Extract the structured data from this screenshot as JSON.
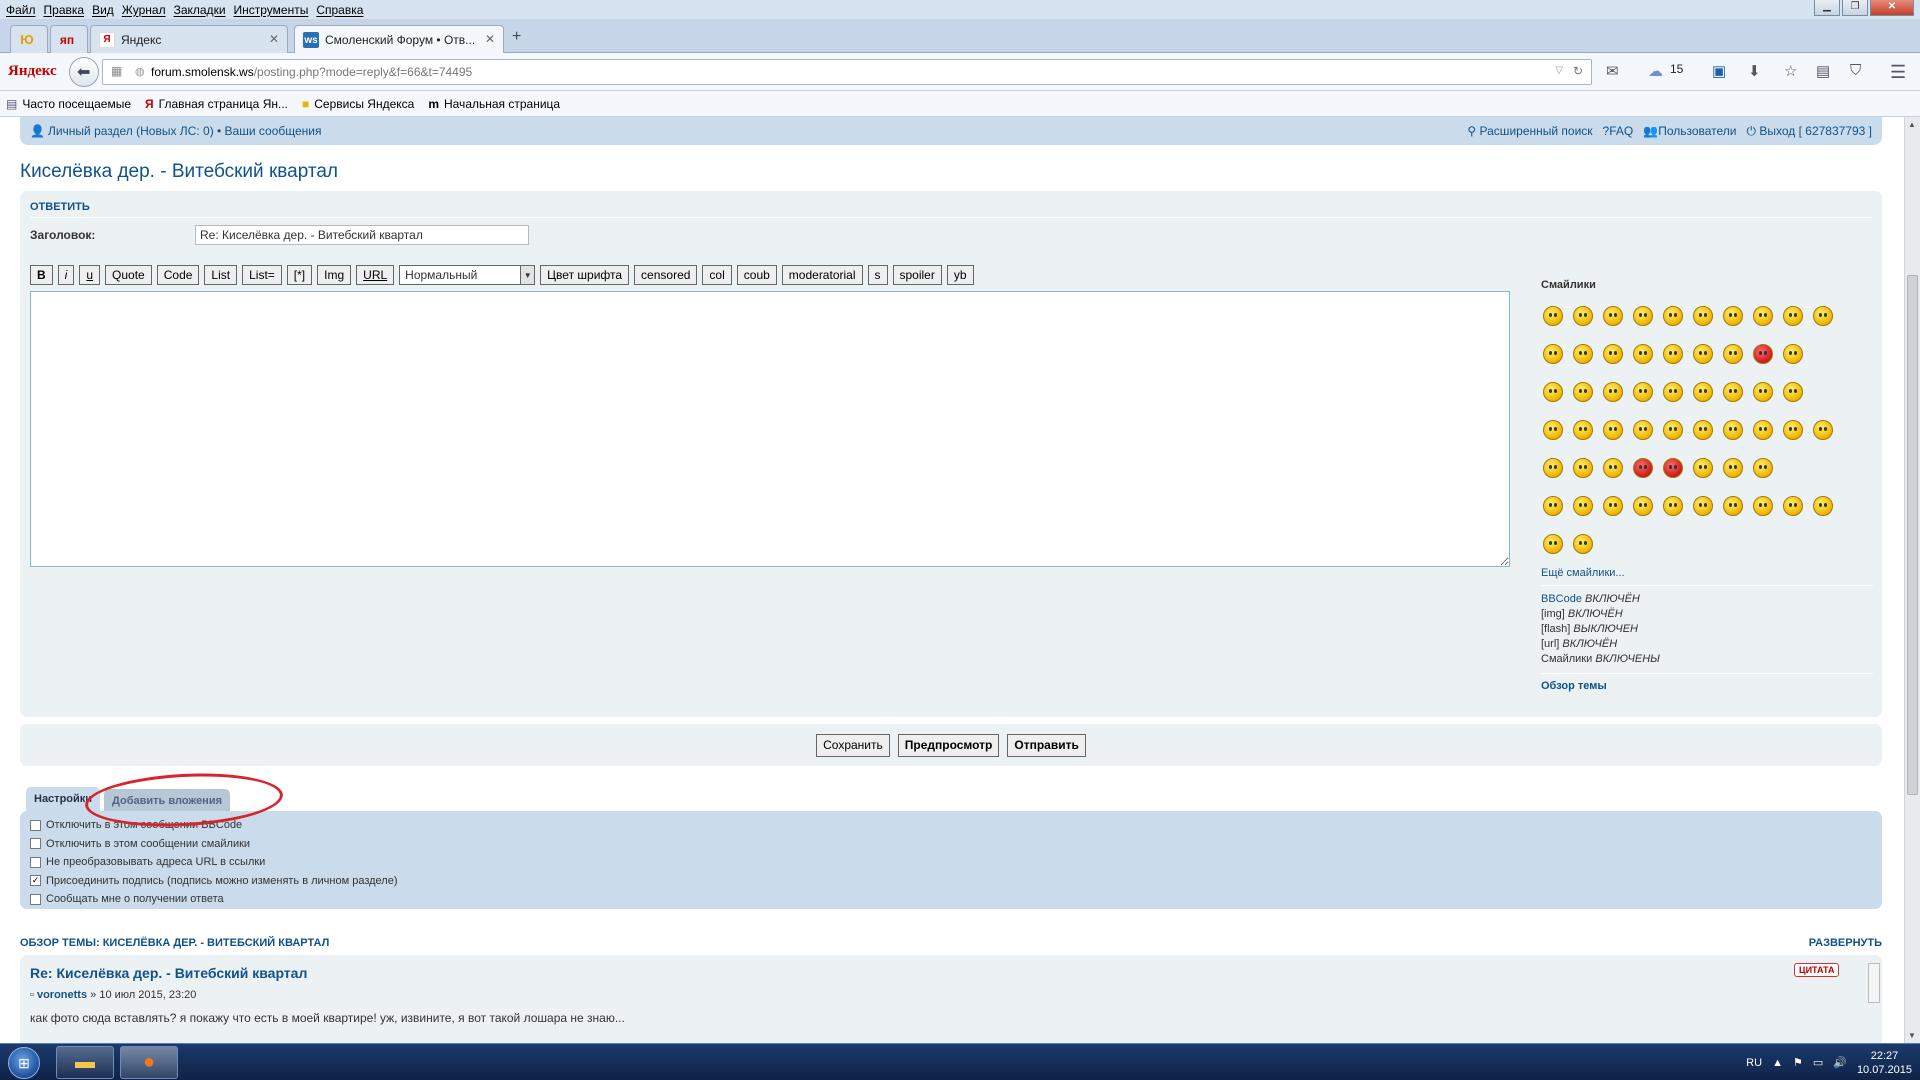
{
  "menubar": {
    "items": [
      "Файл",
      "Правка",
      "Вид",
      "Журнал",
      "Закладки",
      "Инструменты",
      "Справка"
    ]
  },
  "tabs": [
    {
      "label": "",
      "icon": "yandex-launcher-icon"
    },
    {
      "label": "",
      "icon": "yandex-ya-icon"
    },
    {
      "label": "Яндекс",
      "icon": "yandex-favicon"
    },
    {
      "label": "Смоленский Форум • Отв...",
      "icon": "forum-favicon",
      "active": true
    }
  ],
  "nav": {
    "logo": "Яндекс",
    "url_domain": "forum.smolensk.ws",
    "url_path": "/posting.php?mode=reply&f=66&t=74495",
    "weather": "15"
  },
  "bookmarks": [
    "Часто посещаемые",
    "Главная страница Ян...",
    "Сервисы Яндекса",
    "Начальная страница"
  ],
  "forum_nav": {
    "left": "Личный раздел (Новых ЛС: 0) • Ваши сообщения",
    "search": "Расширенный поиск",
    "faq": "FAQ",
    "users": "Пользователи",
    "logout": "Выход [ 627837793 ]"
  },
  "page_title": "Киселёвка дер. - Витебский квартал",
  "post_form": {
    "header": "ОТВЕТИТЬ",
    "subject_label": "Заголовок:",
    "subject_value": "Re: Киселёвка дер. - Витебский квартал",
    "bbcode_buttons": [
      "B",
      "i",
      "u",
      "Quote",
      "Code",
      "List",
      "List=",
      "[*]",
      "Img",
      "URL"
    ],
    "font_size_select": "Нормальный",
    "bbcode_buttons2": [
      "Цвет шрифта",
      "censored",
      "col",
      "coub",
      "moderatorial",
      "s",
      "spoiler",
      "yb"
    ],
    "message_value": ""
  },
  "smilies": {
    "heading": "Смайлики",
    "more_link": "Ещё смайлики...",
    "status": [
      {
        "name": "BBCode",
        "state": "ВКЛЮЧЁН"
      },
      {
        "name": "[img]",
        "state": "ВКЛЮЧЁН"
      },
      {
        "name": "[flash]",
        "state": "ВЫКЛЮЧЕН"
      },
      {
        "name": "[url]",
        "state": "ВКЛЮЧЁН"
      },
      {
        "name": "Смайлики",
        "state": "ВКЛЮЧЕНЫ"
      }
    ],
    "topic_review": "Обзор темы"
  },
  "actions": {
    "save": "Сохранить",
    "preview": "Предпросмотр",
    "submit": "Отправить"
  },
  "option_tabs": {
    "settings": "Настройки",
    "attachments": "Добавить вложения"
  },
  "options": [
    {
      "label": "Отключить в этом сообщении BBCode",
      "checked": false
    },
    {
      "label": "Отключить в этом сообщении смайлики",
      "checked": false
    },
    {
      "label": "Не преобразовывать адреса URL в ссылки",
      "checked": false
    },
    {
      "label": "Присоединить подпись (подпись можно изменять в личном разделе)",
      "checked": true
    },
    {
      "label": "Сообщать мне о получении ответа",
      "checked": false
    }
  ],
  "review": {
    "header": "ОБЗОР ТЕМЫ: КИСЕЛЁВКА ДЕР. - ВИТЕБСКИЙ КВАРТАЛ",
    "expand": "РАЗВЕРНУТЬ",
    "post_title": "Re: Киселёвка дер. - Витебский квартал",
    "quote_btn": "ЦИТАТА",
    "author": "voronetts",
    "date": "» 10 июл 2015, 23:20",
    "text": "как фото сюда вставлять? я покажу что есть в моей квартире! уж, извините, я вот такой лошара не знаю..."
  },
  "taskbar": {
    "lang": "RU",
    "time": "22:27",
    "date": "10.07.2015"
  },
  "colors": {
    "accent": "#105289",
    "panel": "#ecf1f3",
    "panel_blue": "#cadceb",
    "annotation": "#d8242c"
  }
}
